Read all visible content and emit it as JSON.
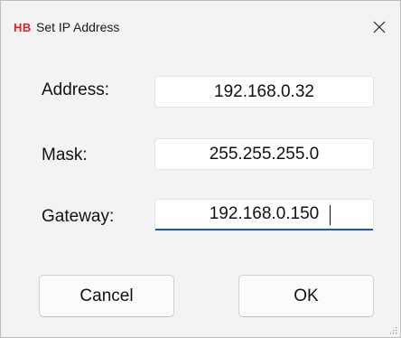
{
  "window": {
    "logo": "HB",
    "title": "Set IP Address",
    "close_glyph": "✕"
  },
  "fields": [
    {
      "label": "Address:",
      "value": "192.168.0.32"
    },
    {
      "label": "Mask:",
      "value": "255.255.255.0"
    },
    {
      "label": "Gateway:",
      "value": "192.168.0.150"
    }
  ],
  "buttons": {
    "cancel": "Cancel",
    "ok": "OK"
  },
  "colors": {
    "logo": "#e02020",
    "focus_underline": "#1e5aa8"
  },
  "icons": {
    "close": "close-icon",
    "resize": "resize-grip-icon"
  }
}
